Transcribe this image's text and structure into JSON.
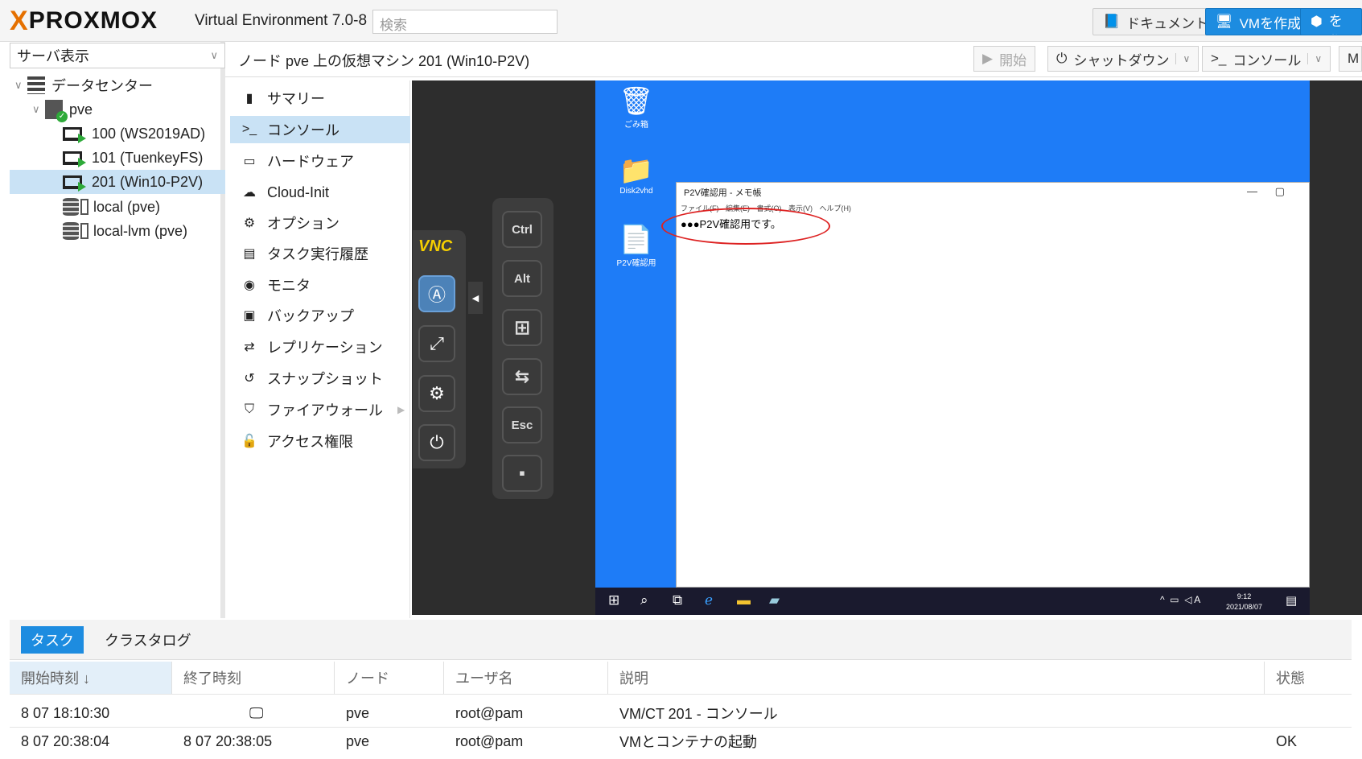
{
  "topbar": {
    "logo_x": "X",
    "logo_text": "PROXMOX",
    "version": "Virtual Environment 7.0-8",
    "search_placeholder": "検索",
    "doc_button": "ドキュメント",
    "create_vm": "VMを作成",
    "create_ct": "CTを作"
  },
  "tree": {
    "view_selector": "サーバ表示",
    "items": [
      {
        "label": "データセンター"
      },
      {
        "label": "pve"
      },
      {
        "label": "100 (WS2019AD)"
      },
      {
        "label": "101 (TuenkeyFS)"
      },
      {
        "label": "201 (Win10-P2V)"
      },
      {
        "label": "local (pve)"
      },
      {
        "label": "local-lvm (pve)"
      }
    ]
  },
  "content": {
    "title": "ノード pve 上の仮想マシン 201 (Win10-P2V)",
    "start_btn": "開始",
    "shutdown_btn": "シャットダウン",
    "console_btn": "コンソール",
    "more_btn": "M"
  },
  "nav": [
    {
      "label": "サマリー",
      "icon": "book-icon"
    },
    {
      "label": "コンソール",
      "icon": "terminal-icon"
    },
    {
      "label": "ハードウェア",
      "icon": "desktop-icon"
    },
    {
      "label": "Cloud-Init",
      "icon": "cloud-icon"
    },
    {
      "label": "オプション",
      "icon": "gear-icon"
    },
    {
      "label": "タスク実行履歴",
      "icon": "list-icon"
    },
    {
      "label": "モニタ",
      "icon": "eye-icon"
    },
    {
      "label": "バックアップ",
      "icon": "floppy-icon"
    },
    {
      "label": "レプリケーション",
      "icon": "retweet-icon"
    },
    {
      "label": "スナップショット",
      "icon": "history-icon"
    },
    {
      "label": "ファイアウォール",
      "icon": "shield-icon"
    },
    {
      "label": "アクセス権限",
      "icon": "unlock-icon"
    }
  ],
  "novnc": {
    "logo": "VNC",
    "keys": [
      "Ctrl",
      "Alt",
      "⊞",
      "⇆",
      "Esc",
      "▪"
    ]
  },
  "desktop": {
    "icons": [
      "ごみ箱",
      "Disk2vhd",
      "P2V確認用"
    ],
    "notepad_title": "P2V確認用 - メモ帳",
    "notepad_menu": "ファイル(F) 編集(E) 書式(O) 表示(V) ヘルプ(H)",
    "notepad_text": "●●●P2V確認用です。",
    "clock_time": "9:12",
    "clock_date": "2021/08/07",
    "tray_ime": "A"
  },
  "bottom": {
    "tab_tasks": "タスク",
    "tab_cluster_log": "クラスタログ",
    "columns": [
      "開始時刻 ↓",
      "終了時刻",
      "ノード",
      "ユーザ名",
      "説明",
      "状態"
    ],
    "rows": [
      {
        "start": "8 07 18:10:30",
        "end": "",
        "node": "pve",
        "user": "root@pam",
        "desc": "VM/CT 201 - コンソール",
        "status": ""
      },
      {
        "start": "8 07 20:38:04",
        "end": "8 07 20:38:05",
        "node": "pve",
        "user": "root@pam",
        "desc": "VMとコンテナの起動",
        "status": "OK"
      }
    ]
  }
}
